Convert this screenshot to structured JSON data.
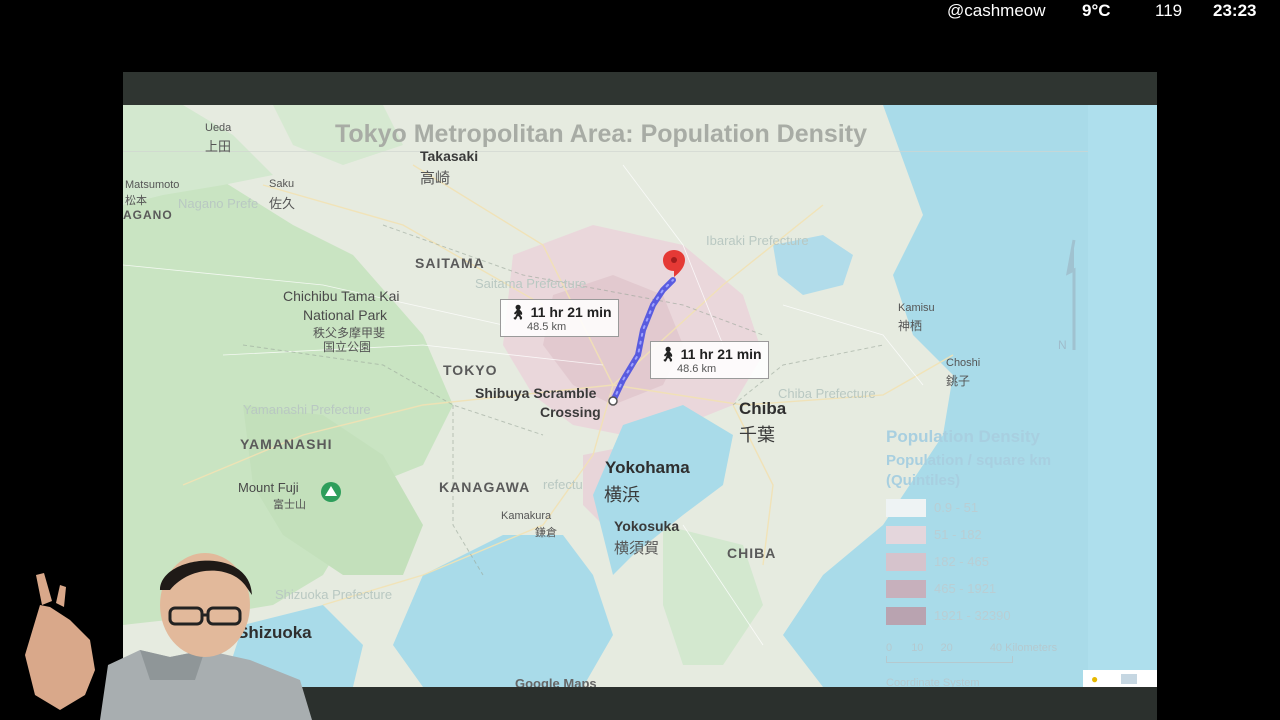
{
  "status_bar": {
    "username": "@cashmeow",
    "temperature": "9°C",
    "count": "119",
    "time": "23:23"
  },
  "map": {
    "title": "Tokyo Metropolitan Area: Population Density",
    "colors": {
      "land": "#e7ecdf",
      "forest": "#c8e3c0",
      "water": "#a9dbe9",
      "urban": "#e9d6da",
      "route": "#4a4fe0",
      "pin": "#e53935"
    },
    "places": {
      "ueda": "Ueda",
      "ueda_kanji": "上田",
      "takasaki": "Takasaki",
      "takasaki_kanji": "高崎",
      "matsumoto": "Matsumoto",
      "matsumoto_kanji": "松本",
      "nagano": "AGANO",
      "saku": "Saku",
      "saku_kanji": "佐久",
      "nagano_pref": "Nagano Prefe",
      "saitama": "SAITAMA",
      "saitama_pref": "Saitama Prefecture",
      "ibaraki_pref": "Ibaraki Prefecture",
      "chichibu": "Chichibu Tama Kai",
      "chichibu2": "National Park",
      "chichibu_kanji": "秩父多摩甲斐",
      "chichibu_kanji2": "国立公園",
      "tokyo": "TOKYO",
      "shibuya": "Shibuya Scramble",
      "shibuya2": "Crossing",
      "kamisu": "Kamisu",
      "kamisu_kanji": "神栖",
      "choshi": "Choshi",
      "choshi_kanji": "銚子",
      "chiba": "Chiba",
      "chiba_kanji": "千葉",
      "chiba_pref": "Chiba Prefecture",
      "yamanashi": "YAMANASHI",
      "yamanashi_pref": "Yamanashi Prefecture",
      "mount_fuji": "Mount Fuji",
      "mount_fuji_kanji": "富士山",
      "kanagawa": "KANAGAWA",
      "kanagawa_pref": "refectu",
      "yokohama": "Yokohama",
      "yokohama_kanji": "横浜",
      "kamakura": "Kamakura",
      "kamakura_kanji": "鎌倉",
      "yokosuka": "Yokosuka",
      "yokosuka_kanji": "横須賀",
      "chiba_region": "CHIBA",
      "shizuoka": "Shizuoka",
      "shizuoka_pref": "Shizuoka Prefecture",
      "google_maps": "Google Maps",
      "north": "N"
    },
    "routes": [
      {
        "time": "11 hr 21 min",
        "distance": "48.5 km",
        "icon": "walking-icon"
      },
      {
        "time": "11 hr 21 min",
        "distance": "48.6 km",
        "icon": "walking-icon"
      }
    ],
    "legend": {
      "title": "Population Density",
      "subtitle": "Population / square km",
      "subtitle2": "(Quintiles)",
      "classes": [
        {
          "label": "0.9 - 51",
          "color": "#eef3f4"
        },
        {
          "label": "51 - 182",
          "color": "#e4d6dc"
        },
        {
          "label": "182 - 465",
          "color": "#d6c3cc"
        },
        {
          "label": "465 - 1921",
          "color": "#c7b0bc"
        },
        {
          "label": "1921 - 32390",
          "color": "#b9a3b0"
        }
      ],
      "scale": {
        "ticks": [
          "0",
          "10",
          "20",
          "40 Kilometers"
        ],
        "note": "Coordinate System"
      }
    }
  }
}
